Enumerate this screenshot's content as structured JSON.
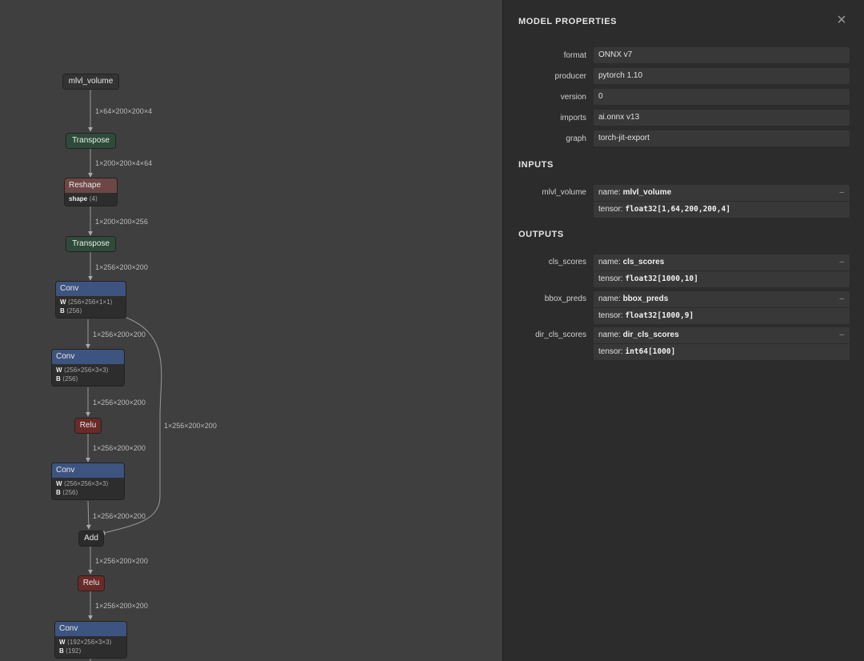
{
  "graph": {
    "nodes": [
      {
        "id": "n_input",
        "title": "mlvl_volume",
        "kind": "input"
      },
      {
        "id": "n_t1",
        "title": "Transpose",
        "kind": "transpose"
      },
      {
        "id": "n_reshape",
        "title": "Reshape",
        "kind": "reshape",
        "attrs": [
          {
            "k": "shape",
            "v": "⟨4⟩"
          }
        ]
      },
      {
        "id": "n_t2",
        "title": "Transpose",
        "kind": "transpose"
      },
      {
        "id": "n_conv1",
        "title": "Conv",
        "kind": "conv",
        "attrs": [
          {
            "k": "W",
            "v": "⟨256×256×1×1⟩"
          },
          {
            "k": "B",
            "v": "⟨256⟩"
          }
        ]
      },
      {
        "id": "n_conv2",
        "title": "Conv",
        "kind": "conv",
        "attrs": [
          {
            "k": "W",
            "v": "⟨256×256×3×3⟩"
          },
          {
            "k": "B",
            "v": "⟨256⟩"
          }
        ]
      },
      {
        "id": "n_relu1",
        "title": "Relu",
        "kind": "relu"
      },
      {
        "id": "n_conv3",
        "title": "Conv",
        "kind": "conv",
        "attrs": [
          {
            "k": "W",
            "v": "⟨256×256×3×3⟩"
          },
          {
            "k": "B",
            "v": "⟨256⟩"
          }
        ]
      },
      {
        "id": "n_add",
        "title": "Add",
        "kind": "add"
      },
      {
        "id": "n_relu2",
        "title": "Relu",
        "kind": "relu"
      },
      {
        "id": "n_conv4",
        "title": "Conv",
        "kind": "conv",
        "attrs": [
          {
            "k": "W",
            "v": "⟨192×256×3×3⟩"
          },
          {
            "k": "B",
            "v": "⟨192⟩"
          }
        ]
      }
    ],
    "edge_labels": [
      "1×64×200×200×4",
      "1×200×200×4×64",
      "1×200×200×256",
      "1×256×200×200",
      "1×256×200×200",
      "1×256×200×200",
      "1×256×200×200",
      "1×256×200×200",
      "1×256×200×200",
      "1×256×200×200"
    ]
  },
  "panel": {
    "title": "MODEL PROPERTIES",
    "close_icon": "×",
    "properties": [
      {
        "label": "format",
        "value": "ONNX v7"
      },
      {
        "label": "producer",
        "value": "pytorch 1.10"
      },
      {
        "label": "version",
        "value": "0"
      },
      {
        "label": "imports",
        "value": "ai.onnx v13"
      },
      {
        "label": "graph",
        "value": "torch-jit-export"
      }
    ],
    "inputs_title": "INPUTS",
    "inputs": [
      {
        "label": "mlvl_volume",
        "name_prefix": "name: ",
        "name": "mlvl_volume",
        "tensor_prefix": "tensor: ",
        "tensor": "float32[1,64,200,200,4]",
        "toggle": "–"
      }
    ],
    "outputs_title": "OUTPUTS",
    "outputs": [
      {
        "label": "cls_scores",
        "name_prefix": "name: ",
        "name": "cls_scores",
        "tensor_prefix": "tensor: ",
        "tensor": "float32[1000,10]",
        "toggle": "–"
      },
      {
        "label": "bbox_preds",
        "name_prefix": "name: ",
        "name": "bbox_preds",
        "tensor_prefix": "tensor: ",
        "tensor": "float32[1000,9]",
        "toggle": "–"
      },
      {
        "label": "dir_cls_scores",
        "name_prefix": "name: ",
        "name": "dir_cls_scores",
        "tensor_prefix": "tensor: ",
        "tensor": "int64[1000]",
        "toggle": "–"
      }
    ]
  }
}
